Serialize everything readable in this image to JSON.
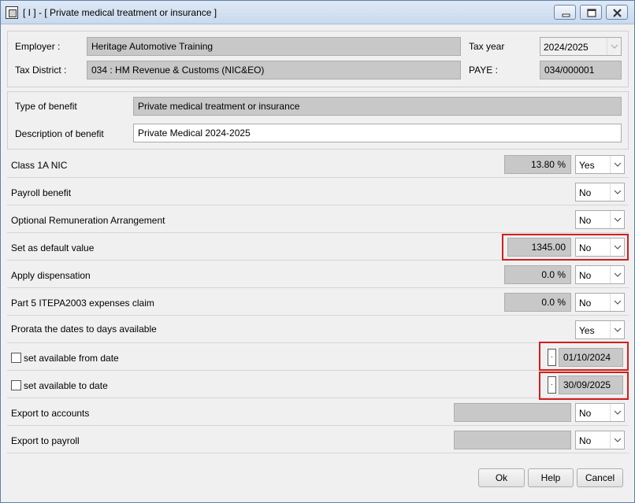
{
  "window": {
    "title": "[ I ] - [ Private medical treatment or insurance ]"
  },
  "header": {
    "employer_label": "Employer :",
    "employer_value": "Heritage Automotive Training",
    "tax_district_label": "Tax District :",
    "tax_district_value": "034 : HM Revenue & Customs (NIC&EO)",
    "tax_year_label": "Tax year",
    "tax_year_value": "2024/2025",
    "paye_label": "PAYE :",
    "paye_value": "034/000001"
  },
  "benefit": {
    "type_label": "Type of benefit",
    "type_value": "Private medical treatment or insurance",
    "description_label": "Description of benefit",
    "description_value": "Private Medical 2024-2025"
  },
  "rows": {
    "class1a": {
      "label": "Class 1A NIC",
      "value": "13.80 %",
      "select": "Yes"
    },
    "payroll_benefit": {
      "label": "Payroll benefit",
      "select": "No"
    },
    "ora": {
      "label": "Optional Remuneration Arrangement",
      "select": "No"
    },
    "default_value": {
      "label": "Set as default value",
      "value": "1345.00",
      "select": "No"
    },
    "dispensation": {
      "label": "Apply dispensation",
      "value": "0.0 %",
      "select": "No"
    },
    "part5": {
      "label": "Part 5 ITEPA2003 expenses claim",
      "value": "0.0 %",
      "select": "No"
    },
    "prorata": {
      "label": "Prorata the dates to days available",
      "select": "Yes"
    },
    "available_from": {
      "label": "set available from date",
      "date": "01/10/2024"
    },
    "available_to": {
      "label": "set available to date",
      "date": "30/09/2025"
    },
    "export_accounts": {
      "label": "Export to accounts",
      "value": "",
      "select": "No"
    },
    "export_payroll": {
      "label": "Export to payroll",
      "value": "",
      "select": "No"
    }
  },
  "buttons": {
    "ok": "Ok",
    "help": "Help",
    "cancel": "Cancel"
  },
  "icons": {
    "app": "app-window-icon",
    "minimize": "minimize-icon",
    "maximize": "maximize-icon",
    "close": "close-icon",
    "dropdown": "chevron-down-icon"
  },
  "colors": {
    "highlight": "#d31e1e",
    "readonly_field": "#c8c8c8",
    "title_bar": "#dfe9f5"
  }
}
